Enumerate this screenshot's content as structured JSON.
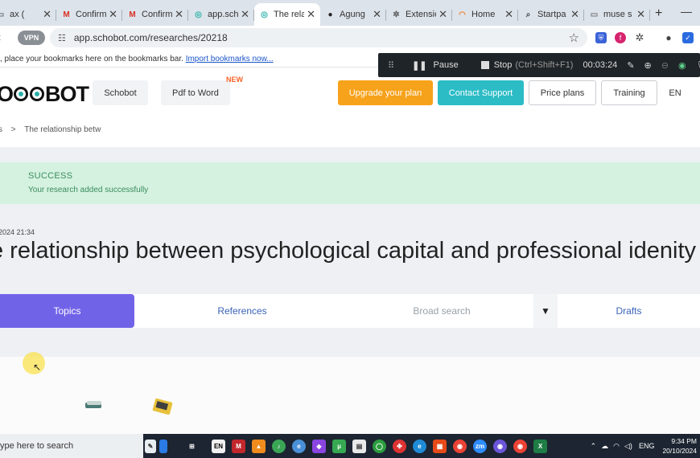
{
  "browser": {
    "tabs": [
      {
        "title": "ax (",
        "icon": "tab-icon",
        "color": "#6b7280"
      },
      {
        "title": "Confirm",
        "icon": "gmail-icon",
        "color": "#d93025"
      },
      {
        "title": "Confirm",
        "icon": "gmail-icon",
        "color": "#d93025"
      },
      {
        "title": "app.scho",
        "icon": "schobot-icon",
        "color": "#2ab0a8"
      },
      {
        "title": "The rela",
        "icon": "schobot-icon",
        "color": "#2ab0a8",
        "active": true
      },
      {
        "title": "Agung",
        "icon": "record-icon",
        "color": "#222222"
      },
      {
        "title": "Extensio",
        "icon": "puzzle-icon",
        "color": "#555555"
      },
      {
        "title": "Home",
        "icon": "home-icon",
        "color": "#f07b2a"
      },
      {
        "title": "Startpa",
        "icon": "search-icon",
        "color": "#444444"
      },
      {
        "title": "muse s",
        "icon": "page-icon",
        "color": "#777777"
      }
    ],
    "new_tab": "+",
    "minimize": "—",
    "vpn_label": "VPN",
    "url": "app.schobot.com/researches/20218",
    "bookmarks_text": ", place your bookmarks here on the bookmarks bar.",
    "bookmarks_link": "Import bookmarks now..."
  },
  "recorder": {
    "pause": "Pause",
    "stop": "Stop",
    "stop_shortcut": "(Ctrl+Shift+F1)",
    "time": "00:03:24"
  },
  "site": {
    "logo": {
      "pre": "O",
      "post": "BOT"
    },
    "nav": {
      "schobot": "Schobot",
      "pdf_to_word": "Pdf to Word",
      "new_badge": "NEW",
      "upgrade": "Upgrade your plan",
      "support": "Contact Support",
      "price": "Price plans",
      "training": "Training",
      "lang": "EN"
    },
    "breadcrumb": {
      "prev": "s",
      "sep": ">",
      "current": "The relationship betw"
    },
    "alert": {
      "title": "SUCCESS",
      "message": "Your research added successfully"
    },
    "date": "2024 21:34",
    "title": "e relationship between psychological capital and professional idenity",
    "tabs": {
      "topics": "Topics",
      "references": "References",
      "broad_search": "Broad search",
      "dropdown": "▼",
      "drafts": "Drafts"
    }
  },
  "taskbar": {
    "search": "ype here to search",
    "lang": "ENG",
    "time": "9:34 PM",
    "date": "20/10/2024"
  }
}
